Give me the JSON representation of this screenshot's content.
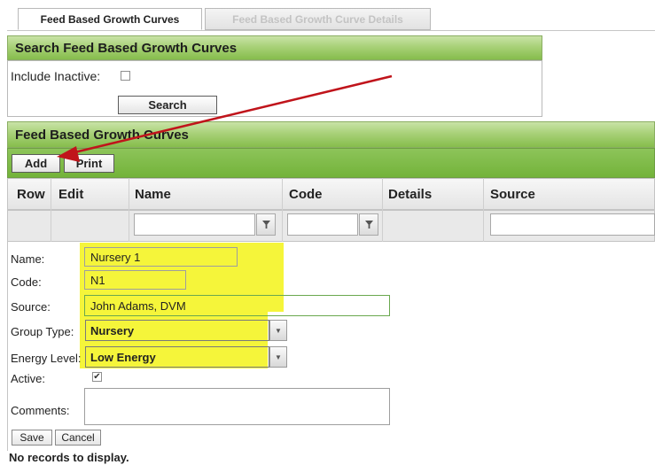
{
  "tabs": [
    {
      "label": "Feed Based Growth Curves",
      "active": true
    },
    {
      "label": "Feed Based Growth Curve Details",
      "active": false
    }
  ],
  "search": {
    "title": "Search Feed Based Growth Curves",
    "include_inactive_label": "Include Inactive:",
    "include_inactive_checked": false,
    "search_button": "Search"
  },
  "grid": {
    "title": "Feed Based Growth Curves",
    "add_button": "Add",
    "print_button": "Print",
    "columns": [
      "Row",
      "Edit",
      "Name",
      "Code",
      "Details",
      "Source"
    ],
    "filter_name_value": "",
    "filter_code_value": "",
    "filter_source_value": "",
    "no_records": "No records to display."
  },
  "form": {
    "name_label": "Name:",
    "name_value": "Nursery 1",
    "code_label": "Code:",
    "code_value": "N1",
    "source_label": "Source:",
    "source_value": "John Adams, DVM",
    "group_type_label": "Group Type:",
    "group_type_value": "Nursery",
    "energy_level_label": "Energy Level:",
    "energy_level_value": "Low Energy",
    "active_label": "Active:",
    "active_checked": true,
    "comments_label": "Comments:",
    "comments_value": "",
    "save_button": "Save",
    "cancel_button": "Cancel"
  },
  "colors": {
    "highlight": "#f5f53a",
    "header_green": "#a8d178",
    "toolbar_green": "#80bc4a",
    "arrow_red": "#c0141b"
  },
  "icons": [
    "filter-icon",
    "dropdown-arrow-icon",
    "checkmark-icon",
    "red-arrow-annotation"
  ]
}
